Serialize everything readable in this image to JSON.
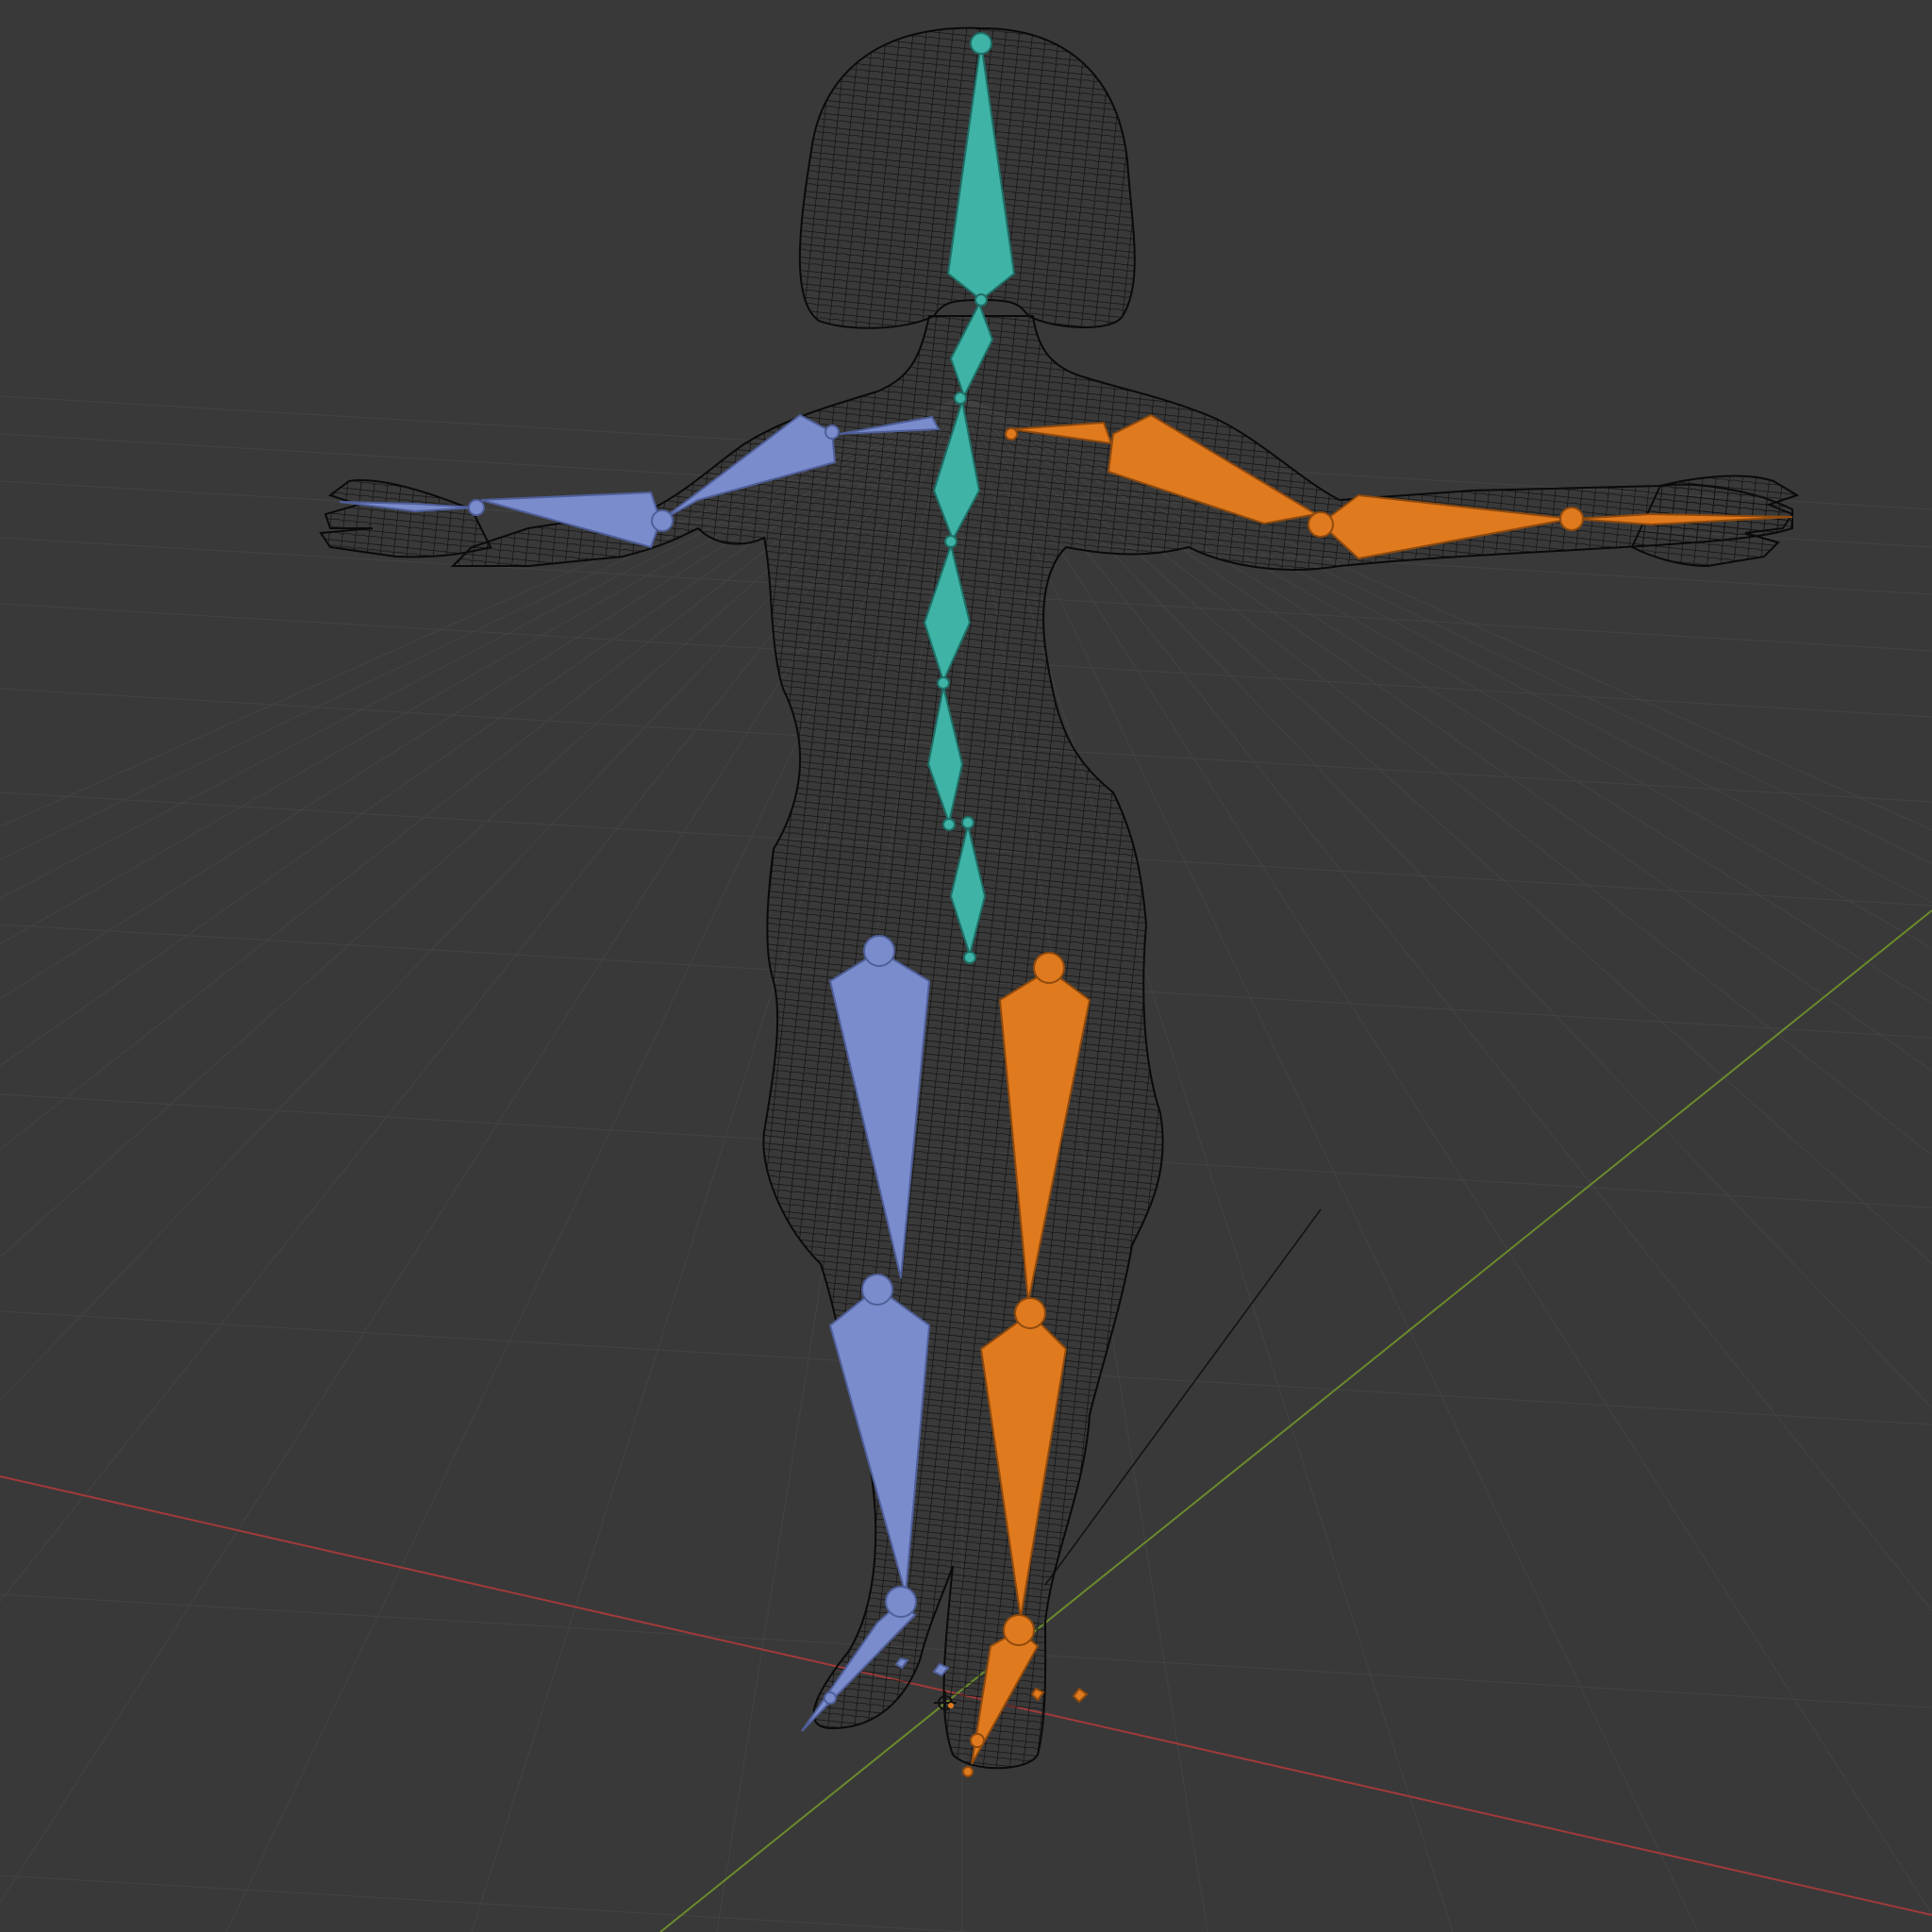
{
  "viewport": {
    "mode": "wireframe",
    "object": "character-mesh",
    "armature_pose": "t-pose",
    "grid": true
  },
  "colors": {
    "background": "#393939",
    "grid_line": "#434343",
    "x_axis": "#a13a3a",
    "y_axis": "#6b8a2c",
    "wire": "#0b0b0b",
    "bone_center": "#3fb3a6",
    "bone_left": "#7b8ccc",
    "bone_right": "#e07a1e",
    "bone_outline_center": "#1f6f66",
    "bone_outline_left": "#4f5f99",
    "bone_outline_right": "#8f4a0e"
  },
  "icons": {
    "cursor": "3d-cursor-icon",
    "origin": "origin-icon"
  }
}
